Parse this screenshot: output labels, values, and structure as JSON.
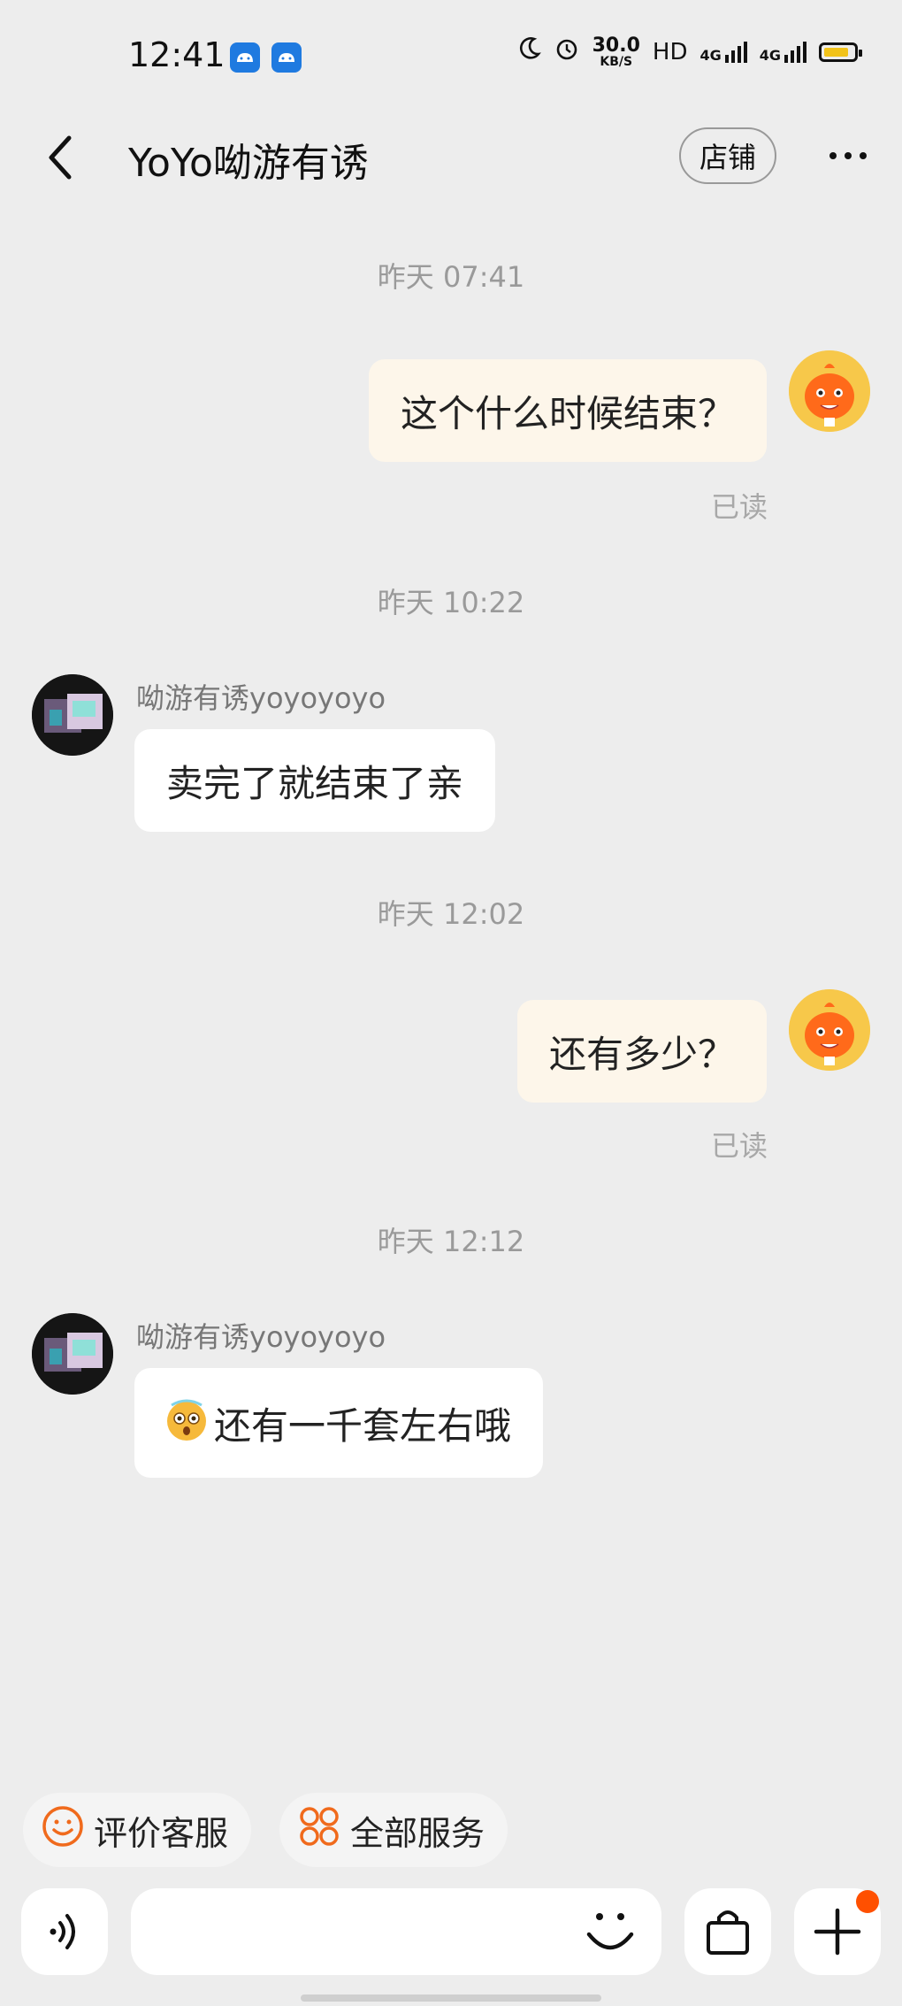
{
  "status_bar": {
    "time": "12:41",
    "speed_value": "30.0",
    "speed_unit": "KB/S",
    "hd": "HD",
    "net1": "4G",
    "net2": "4G"
  },
  "header": {
    "title": "YoYo呦游有诱",
    "shop_label": "店铺"
  },
  "messages": [
    {
      "timestamp": "昨天  07:41",
      "from": "me",
      "text": "这个什么时候结束？",
      "status": "已读"
    },
    {
      "timestamp": "昨天  10:22",
      "from": "them",
      "sender": "呦游有诱yoyoyoyo",
      "text": "卖完了就结束了亲"
    },
    {
      "timestamp": "昨天  12:02",
      "from": "me",
      "text": "还有多少？",
      "status": "已读"
    },
    {
      "timestamp": "昨天  12:12",
      "from": "them",
      "sender": "呦游有诱yoyoyoyo",
      "text": "还有一千套左右哦",
      "emoji": "astonished-emoji"
    }
  ],
  "quick_actions": {
    "rate": "评价客服",
    "all_services": "全部服务"
  },
  "input": {
    "placeholder": ""
  },
  "colors": {
    "accent": "#ff5000",
    "my_bubble": "#fdf6ea",
    "their_bubble": "#ffffff",
    "background": "#ededed"
  }
}
